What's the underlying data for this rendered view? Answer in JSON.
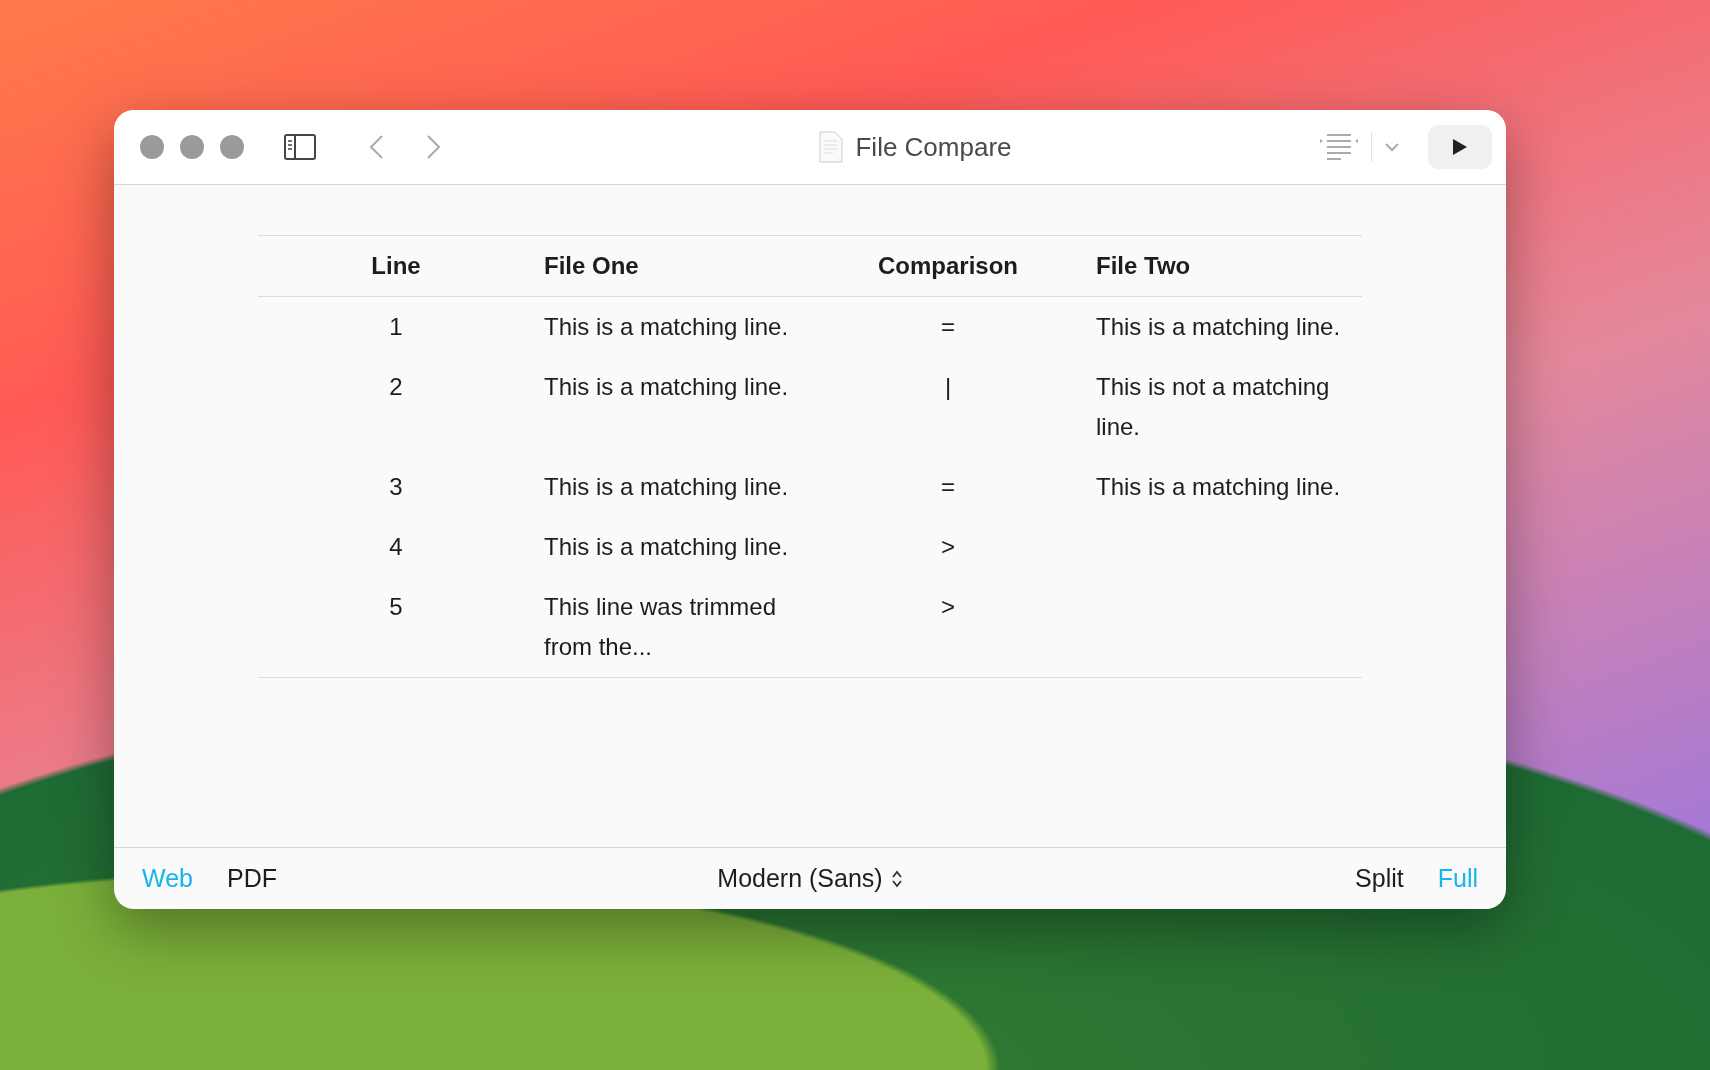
{
  "window": {
    "title": "File Compare"
  },
  "table": {
    "columns": [
      "Line",
      "File One",
      "Comparison",
      "File Two"
    ],
    "rows": [
      {
        "line": "1",
        "file_one": "This is a matching line.",
        "comparison": "=",
        "file_two": "This is a matching line."
      },
      {
        "line": "2",
        "file_one": "This is a matching line.",
        "comparison": "|",
        "file_two": "This is not a matching line."
      },
      {
        "line": "3",
        "file_one": "This is a matching line.",
        "comparison": "=",
        "file_two": "This is a matching line."
      },
      {
        "line": "4",
        "file_one": "This is a matching line.",
        "comparison": ">"
      },
      {
        "line": "5",
        "file_one": "This line was trimmed from the...",
        "comparison": ">"
      }
    ]
  },
  "footer": {
    "formats": [
      {
        "label": "Web",
        "selected": true
      },
      {
        "label": "PDF",
        "selected": false
      }
    ],
    "font_picker": "Modern (Sans)",
    "views": [
      {
        "label": "Split",
        "selected": false
      },
      {
        "label": "Full",
        "selected": true
      }
    ]
  }
}
